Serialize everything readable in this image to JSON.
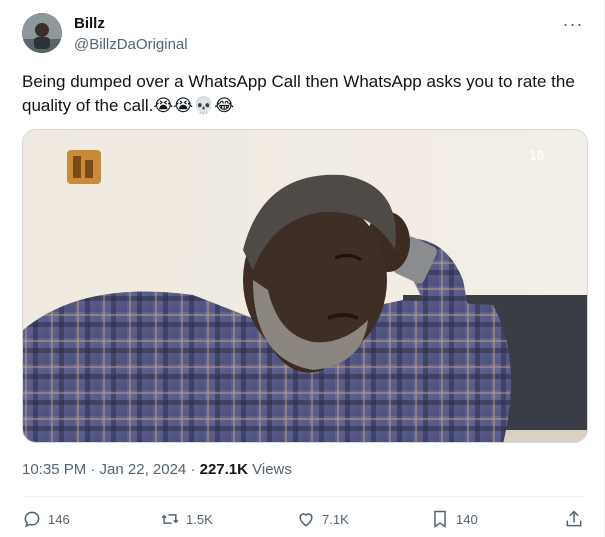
{
  "user": {
    "display_name": "Billz",
    "handle": "@BillzDaOriginal"
  },
  "tweet": {
    "text": "Being dumped over a WhatsApp Call then WhatsApp asks you to rate the quality of the call.",
    "emojis": "😭😭💀😂",
    "media_badge": "16",
    "timestamp": "10:35 PM · Jan 22, 2024 · ",
    "views_count": "227.1K",
    "views_label": " Views"
  },
  "actions": {
    "reply_count": "146",
    "retweet_count": "1.5K",
    "like_count": "7.1K",
    "bookmark_count": "140"
  },
  "colors": {
    "text": "#0f1419",
    "secondary": "#536471",
    "border": "#cfd9de"
  }
}
